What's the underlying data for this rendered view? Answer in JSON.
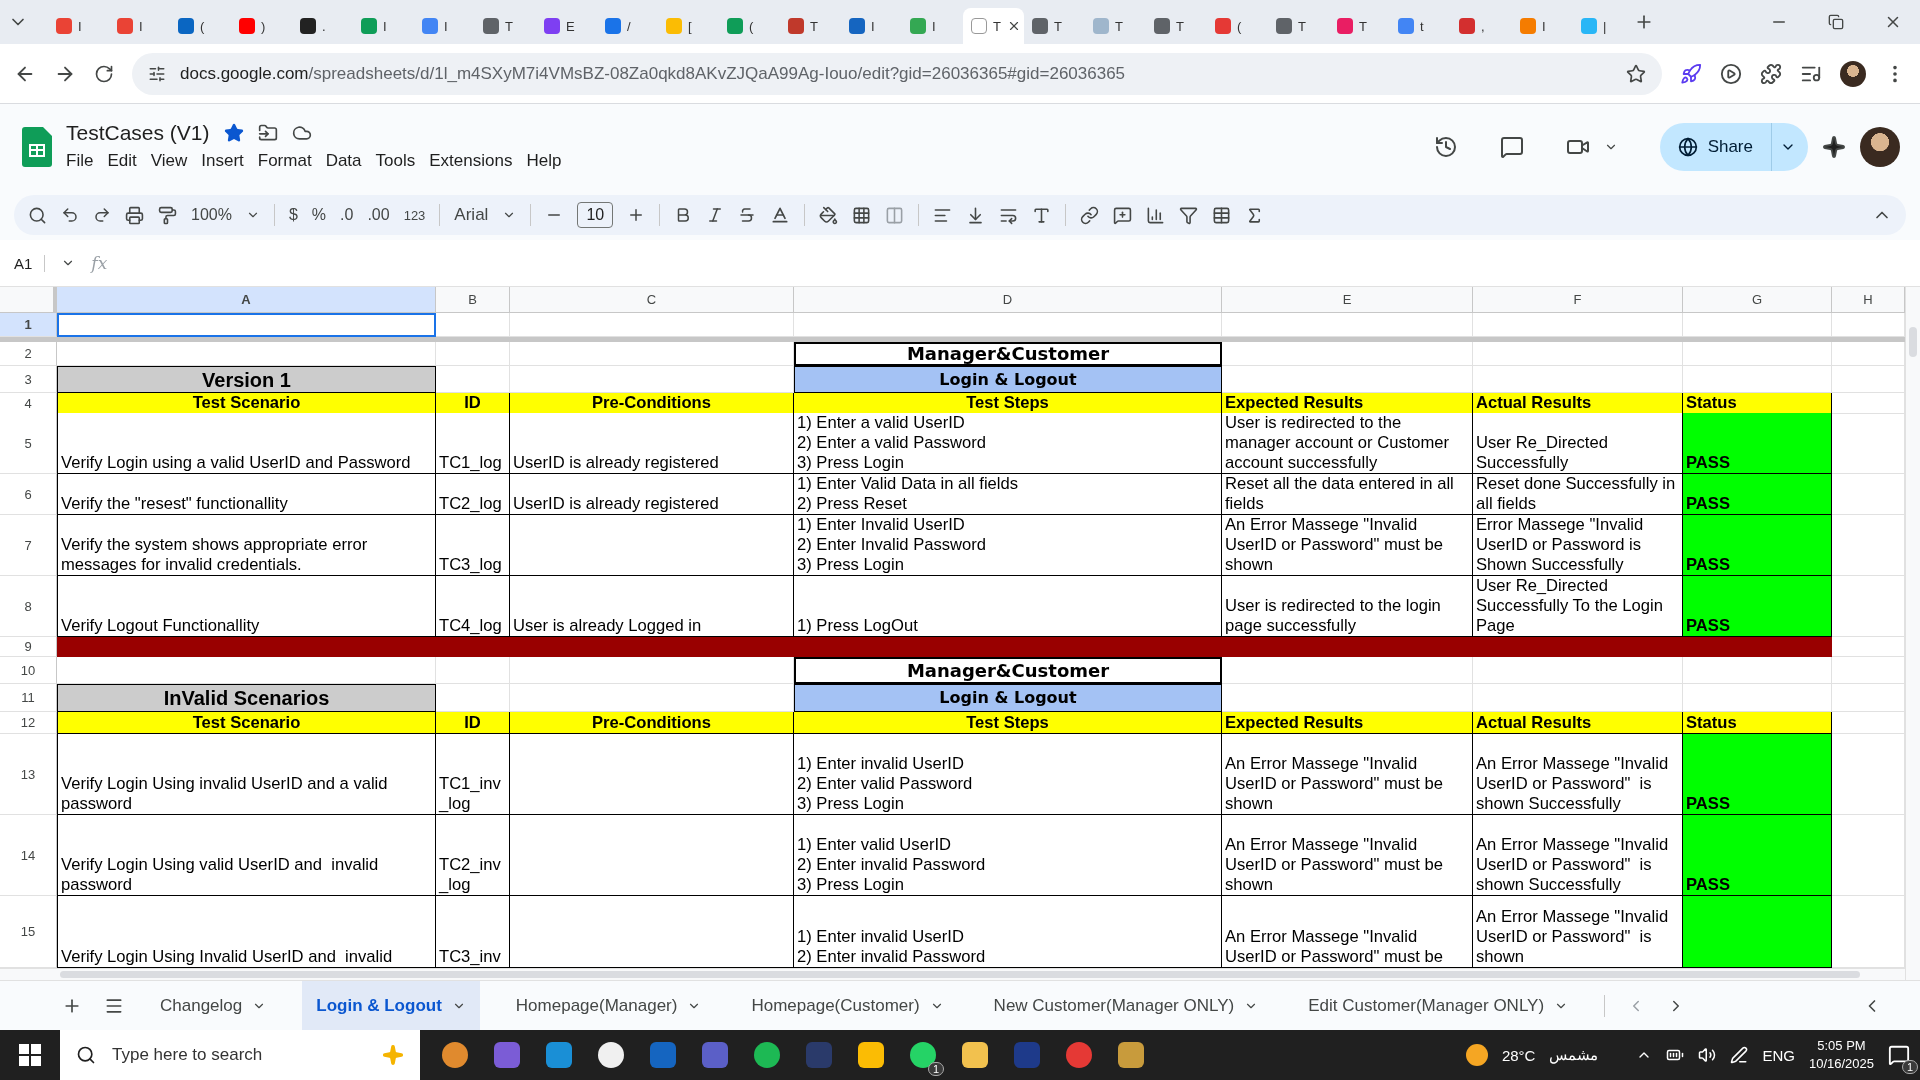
{
  "browser": {
    "tabs": [
      {
        "title": "I",
        "selected": false
      },
      {
        "title": "I",
        "selected": false
      },
      {
        "title": "(",
        "selected": false
      },
      {
        "title": ")",
        "selected": false
      },
      {
        "title": ".",
        "selected": false
      },
      {
        "title": "I",
        "selected": false
      },
      {
        "title": "I",
        "selected": false
      },
      {
        "title": "T",
        "selected": false
      },
      {
        "title": "E",
        "selected": false
      },
      {
        "title": "/",
        "selected": false
      },
      {
        "title": "[",
        "selected": false
      },
      {
        "title": "(",
        "selected": false
      },
      {
        "title": "T",
        "selected": false
      },
      {
        "title": "I",
        "selected": false
      },
      {
        "title": "I",
        "selected": false
      },
      {
        "title": "T",
        "selected": true
      },
      {
        "title": "T",
        "selected": false
      },
      {
        "title": "T",
        "selected": false
      },
      {
        "title": "T",
        "selected": false
      },
      {
        "title": "(",
        "selected": false
      },
      {
        "title": "T",
        "selected": false
      },
      {
        "title": "T",
        "selected": false
      },
      {
        "title": "t",
        "selected": false
      },
      {
        "title": ",",
        "selected": false
      },
      {
        "title": "I",
        "selected": false
      },
      {
        "title": "|",
        "selected": false
      }
    ],
    "url_host": "docs.google.com",
    "url_path": "/spreadsheets/d/1l_m4SXyM7i4VMsBZ-08Za0qkd8AKvZJQaA99Ag-Iouo/edit?gid=26036365#gid=26036365"
  },
  "app": {
    "title": "TestCases (V1)",
    "menus": [
      "File",
      "Edit",
      "View",
      "Insert",
      "Format",
      "Data",
      "Tools",
      "Extensions",
      "Help"
    ],
    "share": "Share"
  },
  "toolbar": {
    "zoom": "100%",
    "currency": "$",
    "percent": "%",
    "decrease_decimals": ".0",
    "increase_decimals": ".00",
    "number_format": "123",
    "font": "Arial",
    "font_size": "10"
  },
  "formula_bar": {
    "cell_ref": "A1",
    "fx": "fx"
  },
  "sheet": {
    "columns": [
      {
        "label": "A",
        "selected": true
      },
      {
        "label": "B",
        "selected": false
      },
      {
        "label": "C",
        "selected": false
      },
      {
        "label": "D",
        "selected": false
      },
      {
        "label": "E",
        "selected": false
      },
      {
        "label": "F",
        "selected": false
      },
      {
        "label": "G",
        "selected": false
      },
      {
        "label": "H",
        "selected": false
      }
    ],
    "rows": [
      {
        "num": "1",
        "kind": "blank",
        "selected": true
      },
      {
        "num": "2",
        "kind": "banner",
        "text": "Manager&Customer"
      },
      {
        "num": "3",
        "kind": "section",
        "title": "Version 1",
        "subtitle": "Login & Logout"
      },
      {
        "num": "4",
        "kind": "header",
        "labels": [
          "Test Scenario",
          "ID",
          "Pre-Conditions",
          "Test Steps",
          "Expected Results",
          "Actual Results",
          "Status"
        ]
      },
      {
        "num": "5",
        "kind": "case",
        "scenario": "Verify Login using a valid UserID and Password",
        "id": "TC1_log",
        "pre": "UserID is already registered",
        "steps": "1) Enter a valid UserID\n2) Enter a valid Password\n3) Press Login",
        "expected": "User is redirected to the manager account or Customer account successfully",
        "actual": "User Re_Directed Successfully",
        "status": "PASS"
      },
      {
        "num": "6",
        "kind": "case",
        "scenario": "Verify the \"resest\" functionallity",
        "id": "TC2_log",
        "pre": "UserID is already registered",
        "steps": "1) Enter Valid Data in all fields\n2) Press Reset",
        "expected": "Reset all the data entered in all fields",
        "actual": "Reset done Successfully in all fields",
        "status": "PASS"
      },
      {
        "num": "7",
        "kind": "case",
        "scenario": "Verify the system shows appropriate error messages for invalid credentials.",
        "id": "TC3_log",
        "steps": "1) Enter Invalid UserID\n2) Enter Invalid Password\n3) Press Login",
        "expected": "An Error Massege \"Invalid UserID or Password\" must be shown",
        "actual": "Error Massege \"Invalid UserID or Password is Shown Successfully",
        "status": "PASS"
      },
      {
        "num": "8",
        "kind": "case",
        "scenario": "Verify Logout Functionallity",
        "id": "TC4_log",
        "pre": "User is already Logged in",
        "steps": "1) Press LogOut",
        "expected": "User is redirected to the login page successfully",
        "actual": "User Re_Directed Successfully To the Login Page",
        "status": "PASS"
      },
      {
        "num": "9",
        "kind": "divider"
      },
      {
        "num": "10",
        "kind": "banner",
        "text": "Manager&Customer"
      },
      {
        "num": "11",
        "kind": "section",
        "title": "InValid Scenarios",
        "subtitle": "Login & Logout"
      },
      {
        "num": "12",
        "kind": "header",
        "labels": [
          "Test Scenario",
          "ID",
          "Pre-Conditions",
          "Test Steps",
          "Expected Results",
          "Actual Results",
          "Status"
        ]
      },
      {
        "num": "13",
        "kind": "case",
        "scenario": "Verify Login Using invalid UserID and a valid password",
        "id": "TC1_inv_log",
        "steps": "1) Enter invalid UserID\n2) Enter valid Password\n3) Press Login",
        "expected": "An Error Massege \"Invalid UserID or Password\" must be shown",
        "actual": "An Error Massege \"Invalid UserID or Password\"  is shown Successfully",
        "status": "PASS"
      },
      {
        "num": "14",
        "kind": "case",
        "scenario": "Verify Login Using valid UserID and  invalid password",
        "id": "TC2_inv_log",
        "steps": "1) Enter valid UserID\n2) Enter invalid Password\n3) Press Login",
        "expected": "An Error Massege \"Invalid UserID or Password\" must be shown",
        "actual": "An Error Massege \"Invalid UserID or Password\"  is shown Successfully",
        "status": "PASS"
      },
      {
        "num": "15",
        "kind": "case",
        "scenario": "Verify Login Using Invalid UserID and  invalid",
        "id": "TC3_inv",
        "steps": "1) Enter invalid UserID\n2) Enter invalid Password",
        "expected": "An Error Massege \"Invalid UserID or Password\" must be",
        "actual": "An Error Massege \"Invalid UserID or Password\"  is shown"
      }
    ]
  },
  "sheet_tabs": [
    {
      "label": "Changelog",
      "selected": false
    },
    {
      "label": "Login & Logout",
      "selected": true
    },
    {
      "label": "Homepage(Manager)",
      "selected": false
    },
    {
      "label": "Homepage(Customer)",
      "selected": false
    },
    {
      "label": "New Customer(Manager ONLY)",
      "selected": false
    },
    {
      "label": "Edit Customer(Manager ONLY)",
      "selected": false
    }
  ],
  "taskbar": {
    "search_placeholder": "Type here to search",
    "app_badge": "1",
    "temperature": "28°C",
    "condition": "مشمس",
    "language": "ENG",
    "time": "5:05 PM",
    "date": "10/16/2025",
    "notifications": "1"
  }
}
